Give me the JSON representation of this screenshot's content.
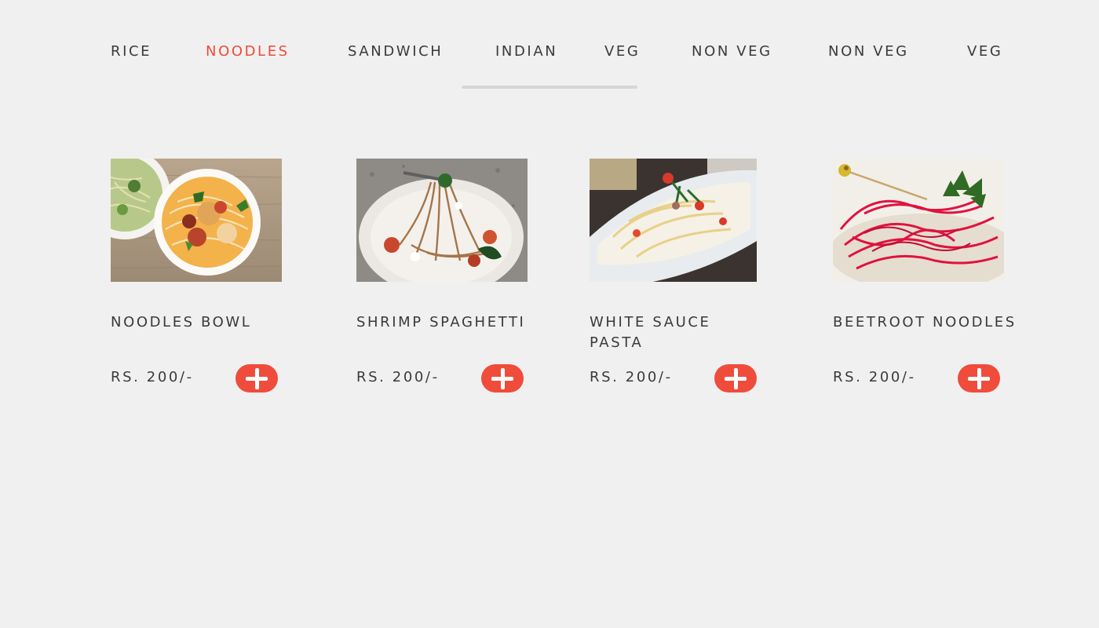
{
  "tabs": [
    {
      "label": "RICE"
    },
    {
      "label": "NOODLES"
    },
    {
      "label": "SANDWICH"
    },
    {
      "label": "INDIAN"
    },
    {
      "label": "VEG"
    },
    {
      "label": "NON VEG"
    },
    {
      "label": "NON VEG"
    },
    {
      "label": "VEG"
    }
  ],
  "active_tab": "NOODLES",
  "accent_color": "#f04c3b",
  "products": [
    {
      "name": "NOODLES BOWL",
      "price": "RS. 200/-",
      "image": "noodles-bowl-photo"
    },
    {
      "name": "SHRIMP SPAGHETTI",
      "price": "RS. 200/-",
      "image": "shrimp-spaghetti-photo"
    },
    {
      "name": "WHITE SAUCE PASTA",
      "price": "RS. 200/-",
      "image": "white-sauce-pasta-photo"
    },
    {
      "name": "BEETROOT NOODLES",
      "price": "RS. 200/-",
      "image": "beetroot-noodles-photo"
    }
  ],
  "icons": {
    "add": "plus-icon"
  }
}
